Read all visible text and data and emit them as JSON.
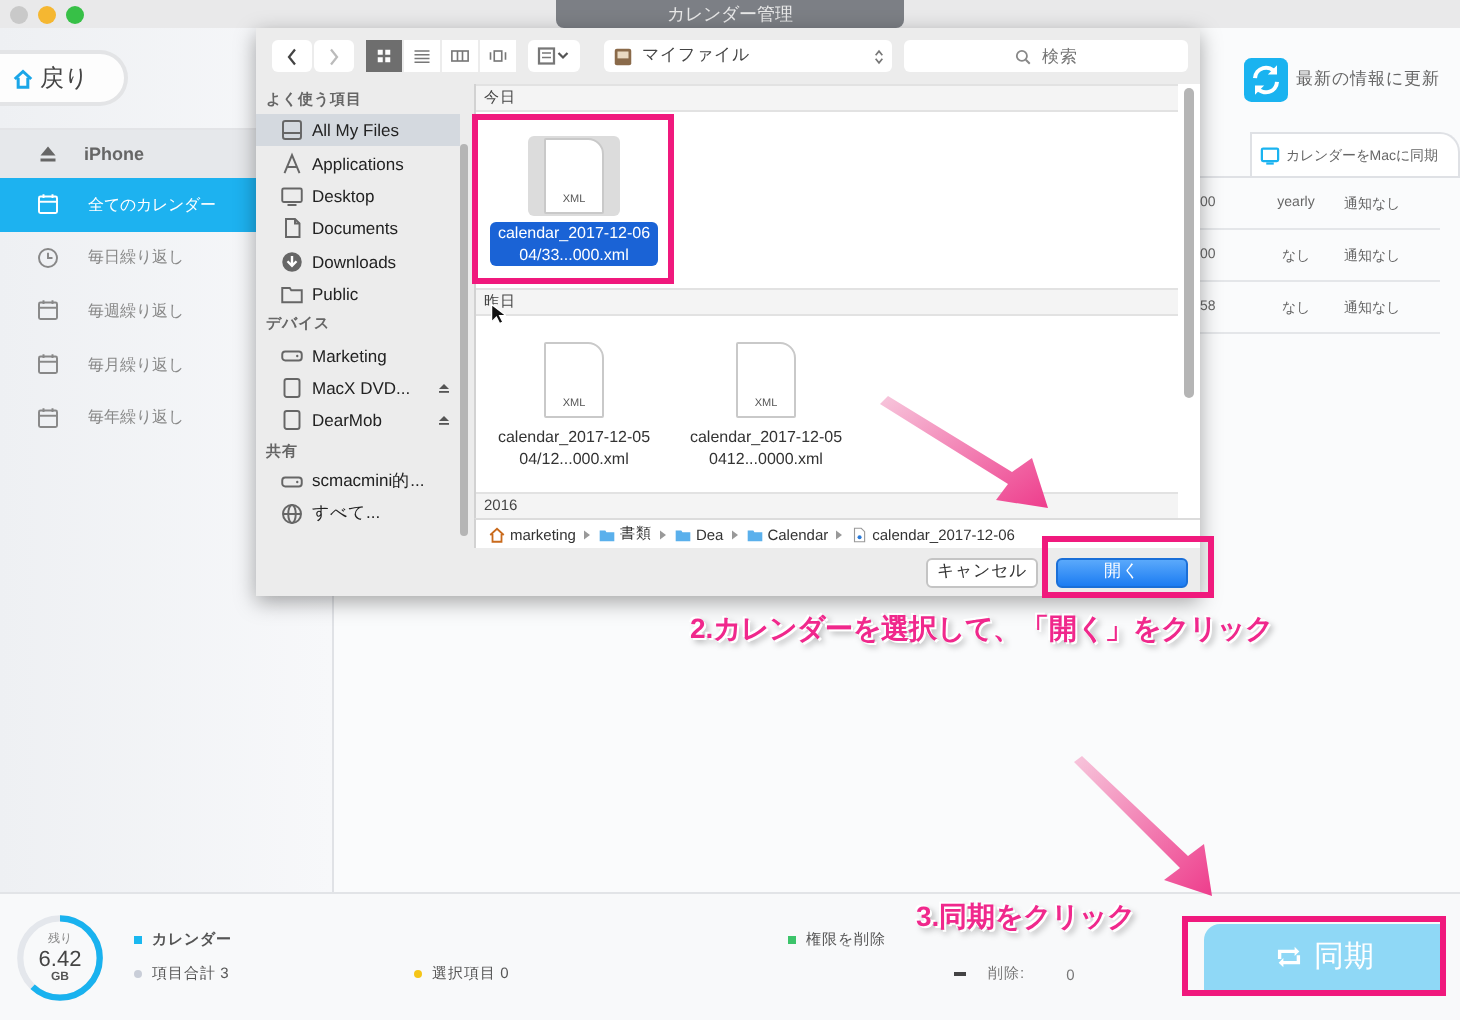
{
  "window": {
    "title": "カレンダー管理"
  },
  "back_button": {
    "label": "戻り"
  },
  "sidebar": {
    "device": "iPhone",
    "items": [
      {
        "label": "全てのカレンダー",
        "selected": true
      },
      {
        "label": "毎日繰り返し",
        "selected": false
      },
      {
        "label": "毎週繰り返し",
        "selected": false
      },
      {
        "label": "毎月繰り返し",
        "selected": false
      },
      {
        "label": "毎年繰り返し",
        "selected": false
      }
    ]
  },
  "refresh": {
    "label": "最新の情報に更新"
  },
  "sync_tab": {
    "label": "カレンダーをMacに同期"
  },
  "table": {
    "rows": [
      [
        "00",
        "yearly",
        "通知なし"
      ],
      [
        "00",
        "なし",
        "通知なし"
      ],
      [
        "58",
        "なし",
        "通知なし"
      ]
    ]
  },
  "storage": {
    "caption": "残り",
    "value": "6.42",
    "unit": "GB",
    "level": 0.62
  },
  "legend": [
    {
      "label": "カレンダー",
      "color": "#1ab8f0"
    },
    {
      "label": "項目合計 3",
      "color": "#c9ced8"
    },
    {
      "label": "選択項目 0",
      "color": "#f5c518"
    },
    {
      "label": "権限を削除",
      "color": "#3cc46a"
    }
  ],
  "delete_stat": {
    "label": "削除:",
    "value": "0"
  },
  "sync_button": {
    "label": "同期"
  },
  "dialog": {
    "location": "マイファイル",
    "search_placeholder": "検索",
    "view_modes": [
      {
        "selected": true
      },
      {
        "selected": false
      },
      {
        "selected": false
      },
      {
        "selected": false
      }
    ],
    "sidebar_sections": [
      {
        "title": "よく使う項目",
        "items": [
          {
            "label": "All My Files",
            "selected": true,
            "eject": false
          },
          {
            "label": "Applications",
            "selected": false,
            "eject": false
          },
          {
            "label": "Desktop",
            "selected": false,
            "eject": false
          },
          {
            "label": "Documents",
            "selected": false,
            "eject": false
          },
          {
            "label": "Downloads",
            "selected": false,
            "eject": false
          },
          {
            "label": "Public",
            "selected": false,
            "eject": false
          }
        ]
      },
      {
        "title": "デバイス",
        "items": [
          {
            "label": "Marketing",
            "selected": false,
            "eject": false
          },
          {
            "label": "MacX DVD...",
            "selected": false,
            "eject": true
          },
          {
            "label": "DearMob",
            "selected": false,
            "eject": true
          }
        ]
      },
      {
        "title": "共有",
        "items": [
          {
            "label": "scmacmini的...",
            "selected": false,
            "eject": false
          },
          {
            "label": "すべて...",
            "selected": false,
            "eject": false
          }
        ]
      }
    ],
    "groups": [
      {
        "title": "今日",
        "files": [
          {
            "name": "calendar_2017-12-06 04/33...000.xml",
            "type_label": "XML",
            "selected": true
          }
        ]
      },
      {
        "title": "昨日",
        "files": [
          {
            "name": "calendar_2017-12-05 04/12...000.xml",
            "type_label": "XML",
            "selected": false
          },
          {
            "name": "calendar_2017-12-05 0412...0000.xml",
            "type_label": "XML",
            "selected": false
          }
        ]
      },
      {
        "title": "2016"
      }
    ],
    "path": [
      "marketing",
      "書類",
      "Dea",
      "Calendar",
      "calendar_2017-12-06"
    ],
    "cancel_button": "キャンセル",
    "open_button": "開く"
  },
  "annotations": [
    {
      "text": "2.カレンダーを選択して、「開く」をクリック"
    },
    {
      "text": "3.同期をクリック"
    }
  ]
}
